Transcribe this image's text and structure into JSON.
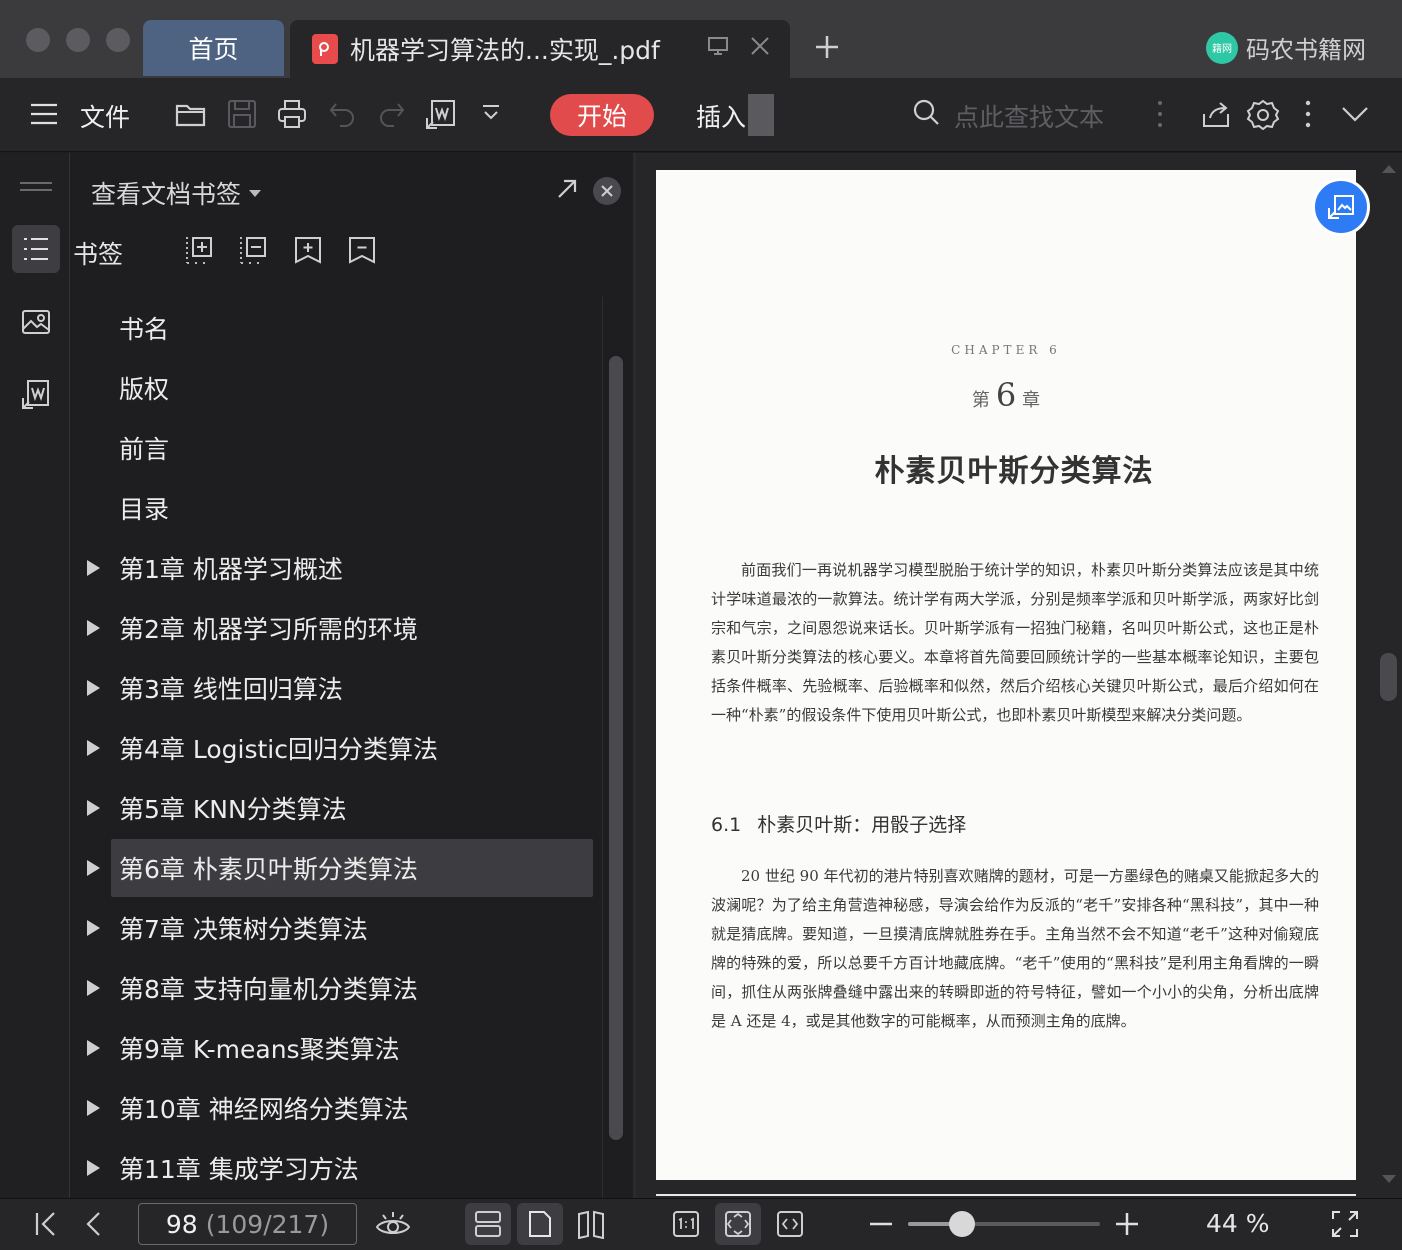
{
  "titlebar": {
    "home_tab": "首页",
    "doc_tab_title": "机器学习算法的...实现_.pdf",
    "brand": "码农书籍网",
    "brand_logo_text": "籍网"
  },
  "toolbar": {
    "file_label": "文件",
    "start_label": "开始",
    "insert_label": "插入",
    "search_placeholder": "点此查找文本"
  },
  "panel": {
    "title": "查看文档书签",
    "bookmarks_label": "书签",
    "items": [
      {
        "label": "书名",
        "expandable": false
      },
      {
        "label": "版权",
        "expandable": false
      },
      {
        "label": "前言",
        "expandable": false
      },
      {
        "label": "目录",
        "expandable": false
      },
      {
        "label": "第1章  机器学习概述",
        "expandable": true
      },
      {
        "label": "第2章  机器学习所需的环境",
        "expandable": true
      },
      {
        "label": "第3章  线性回归算法",
        "expandable": true
      },
      {
        "label": "第4章  Logistic回归分类算法",
        "expandable": true
      },
      {
        "label": "第5章  KNN分类算法",
        "expandable": true
      },
      {
        "label": "第6章  朴素贝叶斯分类算法",
        "expandable": true,
        "selected": true
      },
      {
        "label": "第7章  决策树分类算法",
        "expandable": true
      },
      {
        "label": "第8章  支持向量机分类算法",
        "expandable": true
      },
      {
        "label": "第9章  K-means聚类算法",
        "expandable": true
      },
      {
        "label": "第10章  神经网络分类算法",
        "expandable": true
      },
      {
        "label": "第11章  集成学习方法",
        "expandable": true
      }
    ]
  },
  "document": {
    "chapter_en": "CHAPTER 6",
    "chapter_prefix": "第",
    "chapter_number": "6",
    "chapter_suffix": "章",
    "chapter_title": "朴素贝叶斯分类算法",
    "intro_paragraph": "前面我们一再说机器学习模型脱胎于统计学的知识，朴素贝叶斯分类算法应该是其中统计学味道最浓的一款算法。统计学有两大学派，分别是频率学派和贝叶斯学派，两家好比剑宗和气宗，之间恩怨说来话长。贝叶斯学派有一招独门秘籍，名叫贝叶斯公式，这也正是朴素贝叶斯分类算法的核心要义。本章将首先简要回顾统计学的一些基本概率论知识，主要包括条件概率、先验概率、后验概率和似然，然后介绍核心关键贝叶斯公式，最后介绍如何在一种“朴素”的假设条件下使用贝叶斯公式，也即朴素贝叶斯模型来解决分类问题。",
    "section_number": "6.1",
    "section_title": "朴素贝叶斯：用骰子选择",
    "section_paragraph": "20 世纪 90 年代初的港片特别喜欢赌牌的题材，可是一方墨绿色的赌桌又能掀起多大的波澜呢？为了给主角营造神秘感，导演会给作为反派的“老千”安排各种“黑科技”，其中一种就是猜底牌。要知道，一旦摸清底牌就胜券在手。主角当然不会不知道“老千”这种对偷窥底牌的特殊的爱，所以总要千方百计地藏底牌。“老千”使用的“黑科技”是利用主角看牌的一瞬间，抓住从两张牌叠缝中露出来的转瞬即逝的符号特征，譬如一个小小的尖角，分析出底牌是 A 还是 4，或是其他数字的可能概率，从而预测主角的底牌。"
  },
  "statusbar": {
    "current_page": "98",
    "page_info": "(109/217)",
    "zoom_label": "44 %",
    "zoom_fraction": 0.28
  },
  "colors": {
    "accent_red": "#e24b4b",
    "home_tab": "#4d6381",
    "float_button": "#2d7cf6",
    "brand_logo": "#2fc8a5"
  }
}
